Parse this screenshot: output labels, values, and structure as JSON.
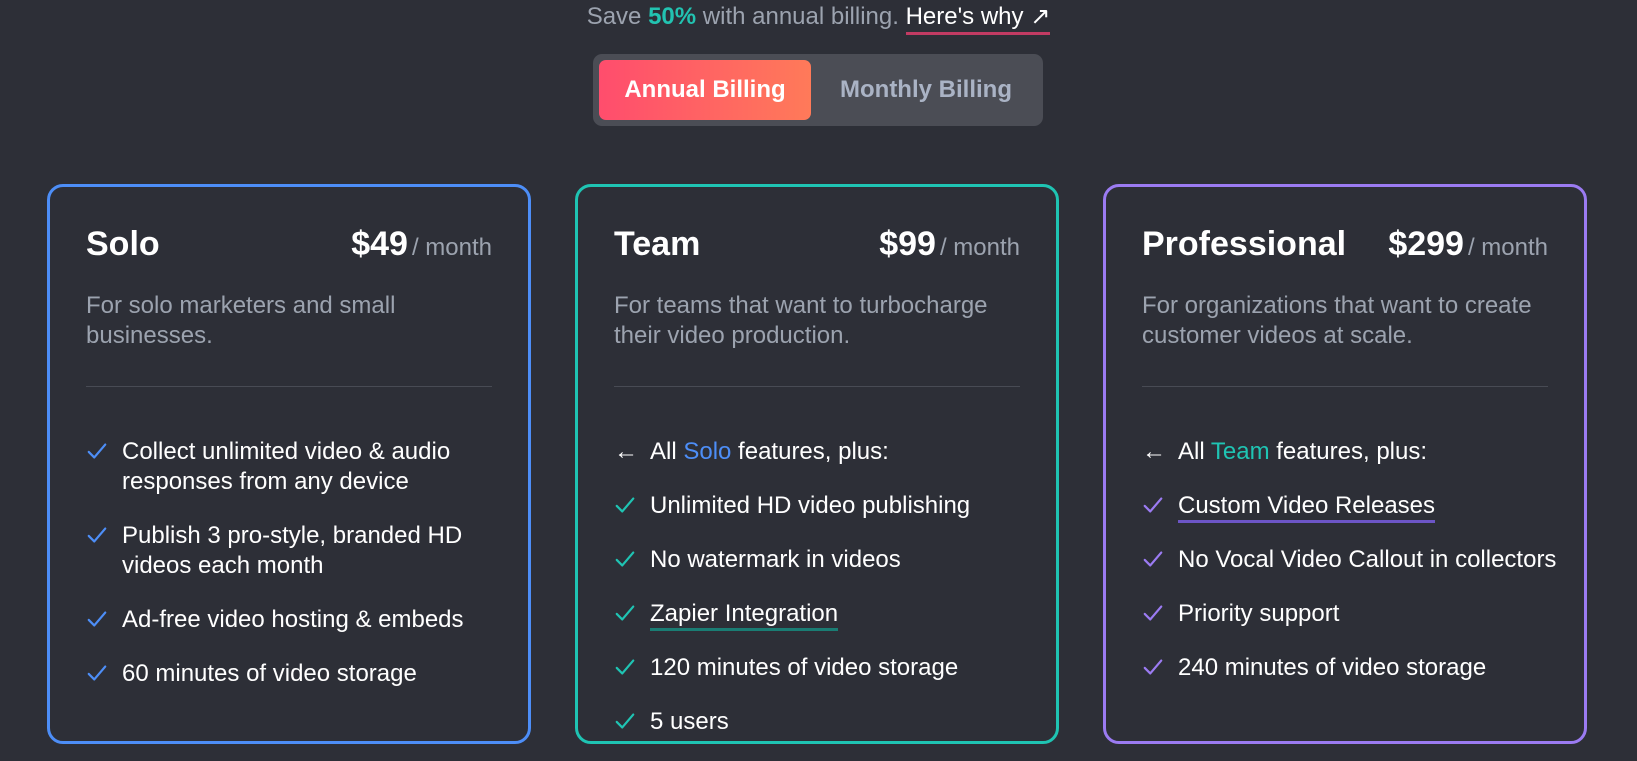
{
  "billing_note": {
    "prefix": "Save ",
    "percent": "50%",
    "middle": " with annual billing. ",
    "link": "Here's why ↗"
  },
  "toggle": {
    "annual": "Annual Billing",
    "monthly": "Monthly Billing",
    "selected": "annual"
  },
  "colors": {
    "solo": "#4d8ef7",
    "team": "#1fc4b3",
    "professional": "#9b7bf2",
    "accent_gradient": [
      "#ff4d6d",
      "#ff7a59"
    ]
  },
  "plans": {
    "solo": {
      "name": "Solo",
      "price": "$49",
      "period": "/ month",
      "description": "For solo marketers and small businesses.",
      "features": [
        "Collect unlimited video & audio responses from any device",
        "Publish 3 pro-style, branded HD videos each month",
        "Ad-free video hosting & embeds",
        "60 minutes of video storage"
      ]
    },
    "team": {
      "name": "Team",
      "price": "$99",
      "period": "/ month",
      "description": "For teams that want to turbocharge their video production.",
      "intro": {
        "arrow": "←",
        "prefix": "All ",
        "plan": "Solo",
        "suffix": " features, plus:"
      },
      "features": [
        "Unlimited HD video publishing",
        "No watermark in videos",
        "Zapier Integration",
        "120 minutes of video storage",
        "5 users"
      ]
    },
    "professional": {
      "name": "Professional",
      "price": "$299",
      "period": "/ month",
      "description": "For organizations that want to create customer videos at scale.",
      "intro": {
        "arrow": "←",
        "prefix": "All ",
        "plan": "Team",
        "suffix": " features, plus:"
      },
      "features": [
        "Custom Video Releases",
        "No Vocal Video Callout in collectors",
        "Priority support",
        "240 minutes of video storage"
      ]
    }
  }
}
